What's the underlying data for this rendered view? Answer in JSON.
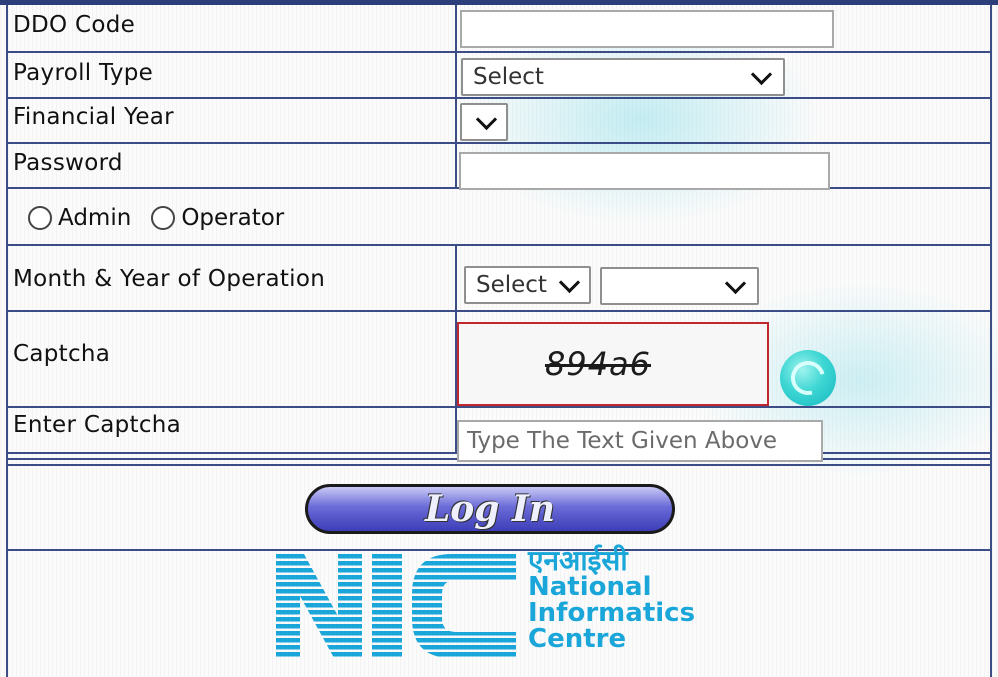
{
  "form": {
    "ddo_code": {
      "label": "DDO Code",
      "value": "",
      "placeholder": ""
    },
    "payroll_type": {
      "label": "Payroll Type",
      "selected": "Select"
    },
    "financial_year": {
      "label": "Financial Year",
      "selected": ""
    },
    "password": {
      "label": "Password",
      "value": ""
    },
    "role": {
      "options": [
        "Admin",
        "Operator"
      ]
    },
    "month_year": {
      "label": "Month & Year of Operation",
      "month_selected": "Select",
      "year_selected": ""
    },
    "captcha": {
      "label": "Captcha",
      "code": "894a6"
    },
    "enter_captcha": {
      "label": "Enter Captcha",
      "placeholder": "Type The Text Given Above"
    },
    "login_label": "Log In"
  },
  "logo": {
    "letters": "NIC",
    "hindi": "एनआईसी",
    "lines": [
      "National",
      "Informatics",
      "Centre"
    ],
    "color": "#1aa6d9"
  },
  "colors": {
    "grid_line": "#3b4c86",
    "captcha_border": "#c0282d",
    "refresh": "#2cc9c9",
    "login_button": "#5a5ad0"
  }
}
